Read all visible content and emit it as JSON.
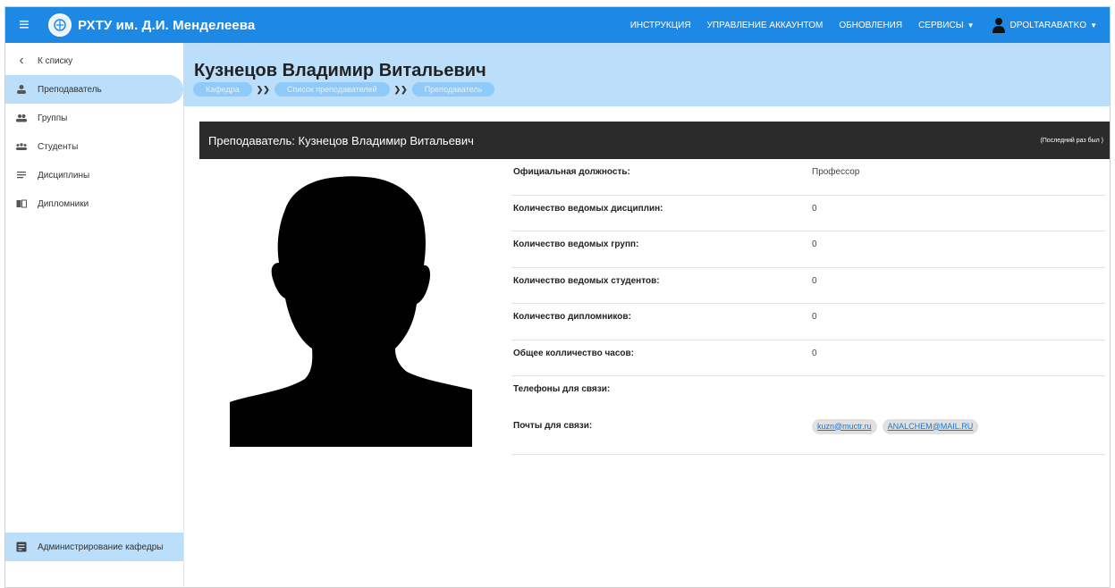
{
  "topbar": {
    "title": "РХТУ им. Д.И. Менделеева",
    "nav": [
      {
        "label": "ИНСТРУКЦИЯ"
      },
      {
        "label": "УПРАВЛЕНИЕ АККАУНТОМ"
      },
      {
        "label": "ОБНОВЛЕНИЯ"
      },
      {
        "label": "СЕРВИСЫ"
      }
    ],
    "user": "DPOLTARABATKO",
    "accent": "#1e88e5"
  },
  "sidebar": {
    "items": [
      {
        "label": "К списку",
        "icon": "chevron-left-icon"
      },
      {
        "label": "Преподаватель",
        "icon": "person-icon"
      },
      {
        "label": "Группы",
        "icon": "group-icon"
      },
      {
        "label": "Студенты",
        "icon": "students-icon"
      },
      {
        "label": "Дисциплины",
        "icon": "list-icon"
      },
      {
        "label": "Дипломники",
        "icon": "book-icon"
      }
    ],
    "bottom": {
      "label": "Администрирование кафедры",
      "icon": "admin-icon"
    }
  },
  "header": {
    "title": "Кузнецов Владимир Витальевич",
    "breadcrumbs": [
      "Кафедра",
      "Список преподавателей",
      "Преподаватель"
    ],
    "background": "#bbdefb"
  },
  "panel": {
    "title": "Преподаватель: Кузнецов Владимир Витальевич",
    "last_seen": "(Последний раз был )"
  },
  "details": [
    {
      "label": "Официальная должность:",
      "value": "Профессор"
    },
    {
      "label": "Количество ведомых дисциплин:",
      "value": "0"
    },
    {
      "label": "Количество ведомых групп:",
      "value": "0"
    },
    {
      "label": "Количество ведомых студентов:",
      "value": "0"
    },
    {
      "label": "Количество дипломников:",
      "value": "0"
    },
    {
      "label": "Общее колличество часов:",
      "value": "0"
    },
    {
      "label": "Телефоны для связи:",
      "value": ""
    }
  ],
  "emails": {
    "label": "Почты для связи:",
    "items": [
      "kuzn@muctr.ru",
      "ANALCHEM@MAIL.RU"
    ]
  }
}
